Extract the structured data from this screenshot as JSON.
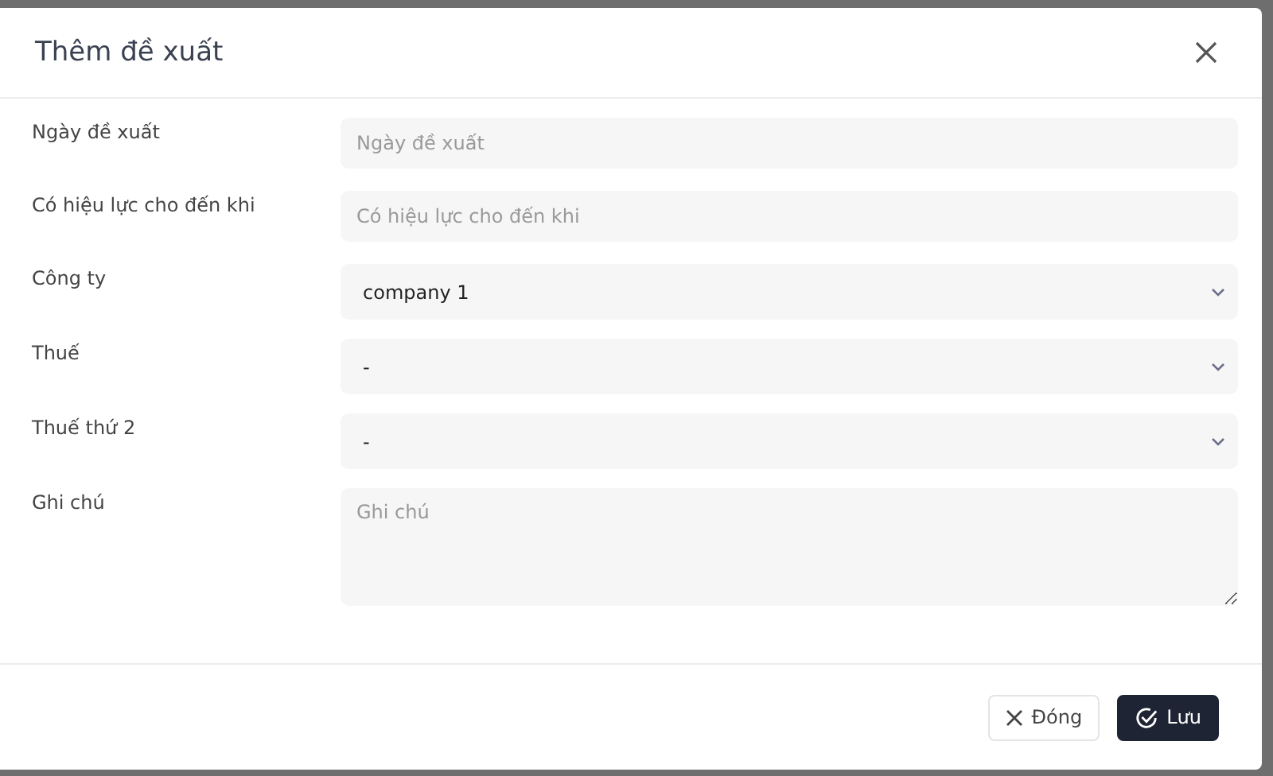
{
  "dialog": {
    "title": "Thêm đề xuất"
  },
  "fields": [
    {
      "label": "Ngày đề xuất",
      "kind": "input",
      "placeholder": "Ngày đề xuất"
    },
    {
      "label": "Có hiệu lực cho đến khi",
      "kind": "input",
      "placeholder": "Có hiệu lực cho đến khi"
    },
    {
      "label": "Công ty",
      "kind": "select",
      "value": "company 1"
    },
    {
      "label": "Thuế",
      "kind": "select",
      "value": "-"
    },
    {
      "label": "Thuế thứ 2",
      "kind": "select",
      "value": "-"
    },
    {
      "label": "Ghi chú",
      "kind": "textarea",
      "placeholder": "Ghi chú"
    }
  ],
  "buttons": [
    {
      "label": "Đóng",
      "kind": "close"
    },
    {
      "label": "Lưu",
      "kind": "save"
    }
  ]
}
